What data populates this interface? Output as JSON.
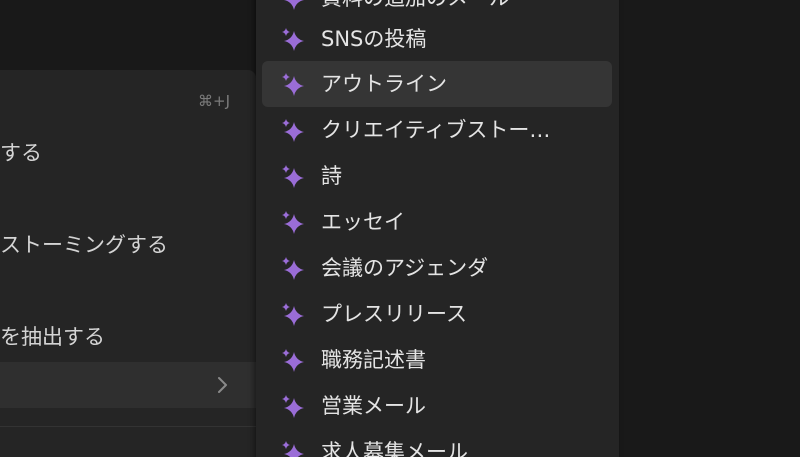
{
  "parent_menu": {
    "items": [
      {
        "label": "する"
      },
      {
        "label": "ストーミングする"
      },
      {
        "label": "を抽出する"
      }
    ],
    "shortcut": "⌘+J"
  },
  "submenu": {
    "items": [
      {
        "label": "資料の追加のメール",
        "icon": "sparkle-icon"
      },
      {
        "label": "SNSの投稿",
        "icon": "sparkle-icon"
      },
      {
        "label": "アウトライン",
        "icon": "sparkle-icon",
        "active": true
      },
      {
        "label": "クリエイティブストー…",
        "icon": "sparkle-icon"
      },
      {
        "label": "詩",
        "icon": "sparkle-icon"
      },
      {
        "label": "エッセイ",
        "icon": "sparkle-icon"
      },
      {
        "label": "会議のアジェンダ",
        "icon": "sparkle-icon"
      },
      {
        "label": "プレスリリース",
        "icon": "sparkle-icon"
      },
      {
        "label": "職務記述書",
        "icon": "sparkle-icon"
      },
      {
        "label": "営業メール",
        "icon": "sparkle-icon"
      },
      {
        "label": "求人募集メール",
        "icon": "sparkle-icon"
      }
    ]
  },
  "colors": {
    "background": "#191919",
    "menu": "#252525",
    "highlight": "#353535",
    "sparkle": "#9a6dd7",
    "text": "#e4e4e4"
  }
}
